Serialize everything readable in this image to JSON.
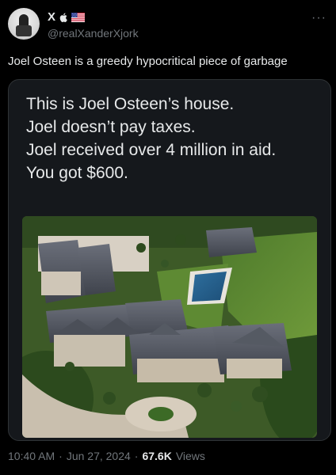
{
  "author": {
    "display_name": "X",
    "handle": "@realXanderXjork",
    "avatar_icon": "avatar-figure-icon",
    "badges": [
      "apple-icon",
      "us-flag-icon"
    ]
  },
  "more_icon": "ellipsis-icon",
  "tweet": {
    "text": "Joel Osteen is a greedy hypocritical piece of garbage"
  },
  "media": {
    "lines": [
      "This is Joel Osteen’s house.",
      "Joel doesn’t pay taxes.",
      "Joel received over 4 million in aid.",
      "You got $600."
    ]
  },
  "meta": {
    "time": "10:40 AM",
    "date": "Jun 27, 2024",
    "views_count": "67.6K",
    "views_label": "Views",
    "separator": "·"
  },
  "colors": {
    "background": "#000000",
    "card": "#15181c",
    "text": "#e7e9ea",
    "muted": "#71767b",
    "border": "#2f3336"
  }
}
